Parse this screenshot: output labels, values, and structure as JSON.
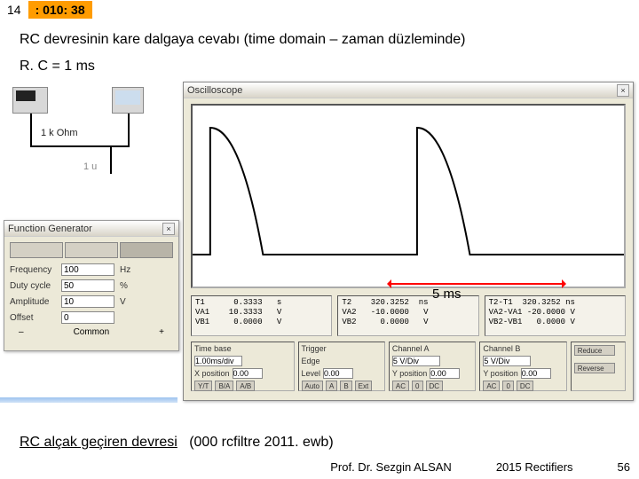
{
  "top": {
    "seg1": "14",
    "seg2": ": 010: 38"
  },
  "title": "RC devresinin kare dalgaya cevabı (time domain – zaman düzleminde)",
  "rc": "R. C = 1 ms",
  "circuit": {
    "r": "1 k Ohm",
    "c": "1 u"
  },
  "fgen": {
    "title": "Function Generator",
    "close": "×",
    "rows": [
      {
        "label": "Frequency",
        "value": "100",
        "unit": "Hz"
      },
      {
        "label": "Duty cycle",
        "value": "50",
        "unit": "%"
      },
      {
        "label": "Amplitude",
        "value": "10",
        "unit": "V"
      },
      {
        "label": "Offset",
        "value": "0",
        "unit": ""
      }
    ],
    "out": {
      "minus": "–",
      "common": "Common",
      "plus": "+"
    }
  },
  "osc": {
    "title": "Oscilloscope",
    "close": "×",
    "five_ms": "5 ms",
    "readouts": {
      "r1": "T1      0.3333   s\nVA1    10.3333   V\nVB1     0.0000   V",
      "r2": "T2    320.3252  ns\nVA2   -10.0000   V\nVB2     0.0000   V",
      "r3": "T2-T1  320.3252 ns\nVA2-VA1 -20.0000 V\nVB2-VB1   0.0000 V"
    },
    "timebase": {
      "title": "Time base",
      "scale": "1.00ms/div",
      "xpos_lbl": "X position",
      "xpos": "0.00",
      "btns": [
        "Y/T",
        "B/A",
        "A/B"
      ]
    },
    "trigger": {
      "title": "Trigger",
      "edge_lbl": "Edge",
      "level_lbl": "Level",
      "level": "0.00",
      "btns": [
        "Auto",
        "A",
        "B",
        "Ext"
      ]
    },
    "chA": {
      "title": "Channel A",
      "scale": "5 V/Div",
      "ypos_lbl": "Y position",
      "ypos": "0.00",
      "btns": [
        "AC",
        "0",
        "DC"
      ]
    },
    "chB": {
      "title": "Channel B",
      "scale": "5 V/Div",
      "ypos_lbl": "Y position",
      "ypos": "0.00",
      "btns": [
        "AC",
        "0",
        "DC"
      ]
    },
    "reduce": "Reduce",
    "reverse": "Reverse"
  },
  "bottom": {
    "link": "RC alçak geçiren devresi",
    "file": "(000 rcfiltre 2011. ewb)"
  },
  "footer": {
    "author": "Prof. Dr. Sezgin ALSAN",
    "course": "2015 Rectifiers",
    "page": "56"
  }
}
